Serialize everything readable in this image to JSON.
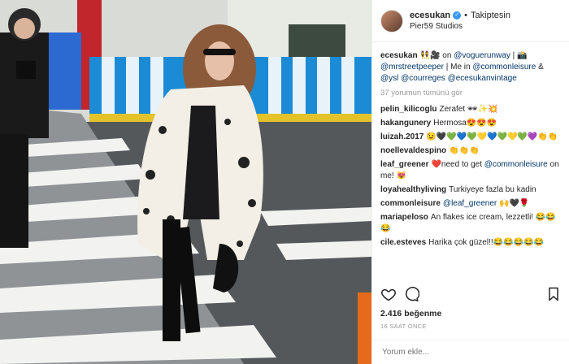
{
  "header": {
    "username": "ecesukan",
    "verified_icon": "verified-badge-icon",
    "separator": "•",
    "follow_status": "Takiptesin",
    "location": "Pier59 Studios"
  },
  "caption": {
    "username": "ecesukan",
    "parts": [
      "👯‍♀️🎥 on ",
      "@voguerunway",
      " | 📸 ",
      "@mrstreetpeeper",
      " | Me in ",
      "@commonleisure",
      " & ",
      "@ysl",
      " ",
      "@courreges",
      " ",
      "@ecesukanvintage"
    ]
  },
  "view_all_comments": "37 yorumun tümünü gör",
  "comments": [
    {
      "username": "pelin_kilicoglu",
      "text": "Zerafet 🕶✨💥"
    },
    {
      "username": "hakangunery",
      "text": "Hermosa😍😍😍"
    },
    {
      "username": "luizah.2017",
      "text": "😉🖤💚💙💚💛💙💚💛💚💜👏👏"
    },
    {
      "username": "noellevaldespino",
      "text": "👏👏👏"
    },
    {
      "username": "leaf_greener",
      "text": "❤️need to get ",
      "link": "@commonleisure",
      "after": " on me! 😻"
    },
    {
      "username": "loyahealthyliving",
      "text": "Turkiyeye fazla bu kadin"
    },
    {
      "username": "commonleisure",
      "text": "",
      "link": "@leaf_greener",
      "after": " 🙌🖤🌹"
    },
    {
      "username": "mariapeloso",
      "text": "An flakes ice cream, lezzetli! 😂😂😂"
    },
    {
      "username": "cile.esteves",
      "text": "Harika çok güzel!!😂😂😂😂😂"
    }
  ],
  "actions": {
    "like_icon": "heart-icon",
    "comment_icon": "comment-bubble-icon",
    "save_icon": "bookmark-icon"
  },
  "likes": "2.416 beğenme",
  "time_ago": "16 SAAT ÖNCE",
  "add_comment": {
    "placeholder": "Yorum ekle..."
  }
}
